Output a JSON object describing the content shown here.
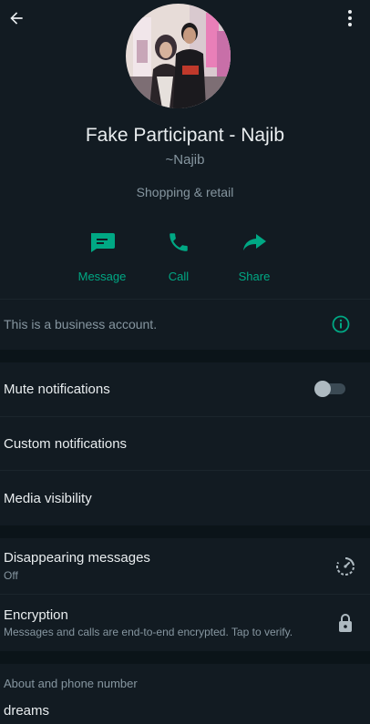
{
  "header": {
    "back_icon": "arrow-left-icon",
    "menu_icon": "more-vertical-icon"
  },
  "profile": {
    "name": "Fake Participant - Najib",
    "pushname": "~Najib",
    "category": "Shopping & retail"
  },
  "actions": [
    {
      "label": "Message",
      "icon": "message-icon"
    },
    {
      "label": "Call",
      "icon": "phone-icon"
    },
    {
      "label": "Share",
      "icon": "share-icon"
    }
  ],
  "business_notice": {
    "text": "This is a business account.",
    "icon": "info-icon"
  },
  "settings": {
    "mute_label": "Mute notifications",
    "mute_enabled": false,
    "custom_label": "Custom notifications",
    "media_label": "Media visibility"
  },
  "privacy": {
    "disappearing_label": "Disappearing messages",
    "disappearing_value": "Off",
    "encryption_label": "Encryption",
    "encryption_desc": "Messages and calls are end-to-end encrypted. Tap to verify."
  },
  "about": {
    "section_label": "About and phone number",
    "text": "dreams"
  },
  "colors": {
    "background": "#121b22",
    "section_gap": "#0b1419",
    "accent": "#00a884",
    "primary_text": "#e9edef",
    "secondary_text": "#8696a0"
  }
}
